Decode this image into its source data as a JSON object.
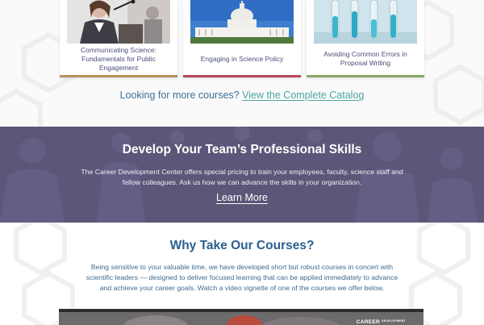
{
  "courses": [
    {
      "title": "Communicating Science: Fundamentals for Public Engagement",
      "image": "speaker-at-podium-photo",
      "accent_color": "#b3915a"
    },
    {
      "title": "Engaging in Science Policy",
      "image": "capitol-building-photo",
      "accent_color": "#b8485c"
    },
    {
      "title": "Avoiding Common Errors in Proposal Writing",
      "image": "test-tubes-photo",
      "accent_color": "#88a866"
    }
  ],
  "catalog": {
    "prompt": "Looking for more courses?",
    "link_label": "View the Complete Catalog"
  },
  "team": {
    "title": "Develop Your Team’s Professional Skills",
    "text": "The Career Development Center offers special pricing to train your employees, faculty, science staff and fellow colleagues. Ask us how we can advance the skills in your organization.",
    "cta": "Learn More",
    "background_color": "#5c5678"
  },
  "why": {
    "title": "Why Take Our Courses?",
    "text": "Being sensitive to your valuable time, we have developed short but robust courses in concert with scientific leaders — designed to deliver focused learning that can be applied immediately to advance and achieve your career goals. Watch a video vignette of one of the courses we offer below."
  },
  "video": {
    "label": "CAREER",
    "label_small": "DEVELOPMENT"
  },
  "colors": {
    "heading_blue": "#2b5f8e",
    "link_teal": "#4ba69c",
    "body_blue": "#3f6a90"
  }
}
